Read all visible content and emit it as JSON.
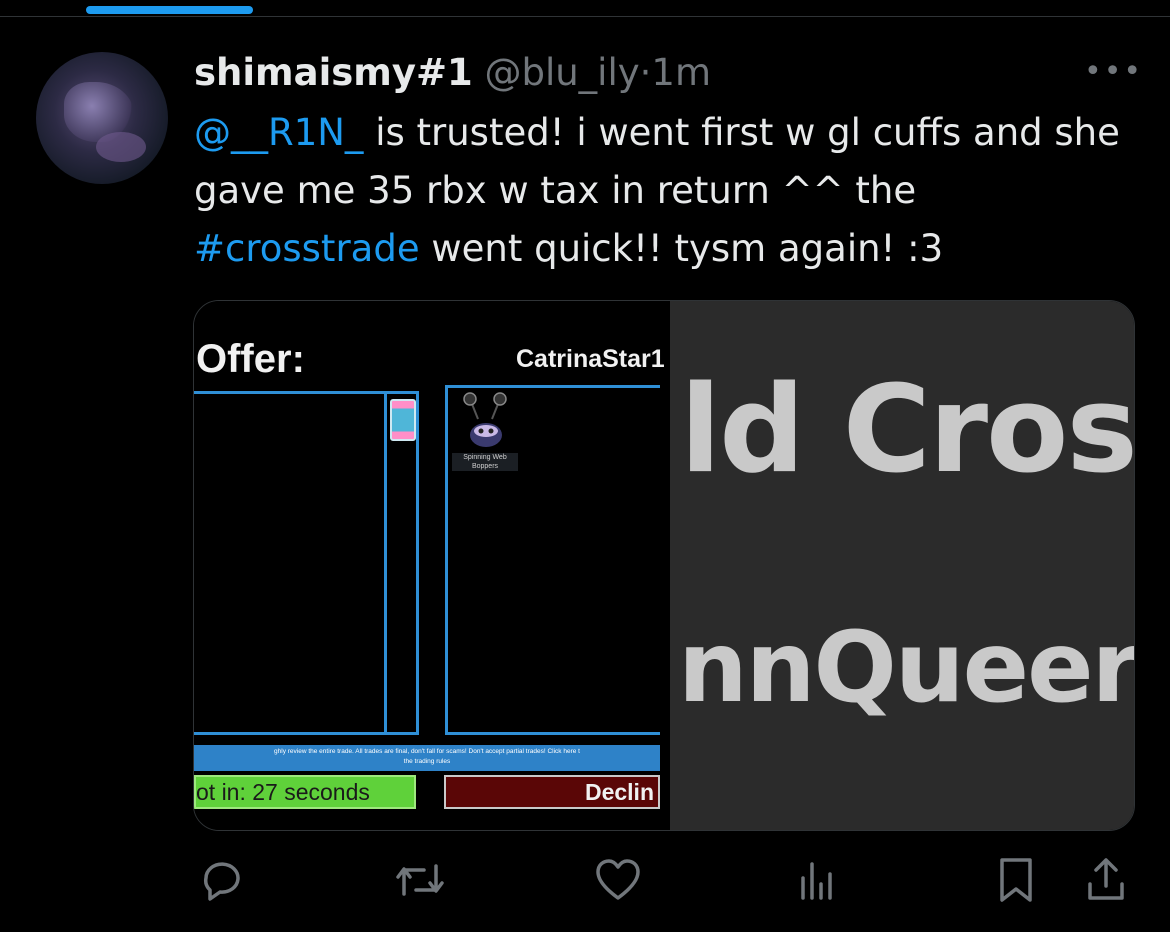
{
  "tweet": {
    "display_name": "shimaismy#1",
    "handle": "@blu_ily",
    "separator": "·",
    "time": "1m",
    "more": "•••",
    "text_parts": [
      {
        "type": "mention",
        "text": "@__R1N_"
      },
      {
        "type": "text",
        "text": " is trusted! i went first w gl cuffs and she gave me 35 rbx w tax in return ^^ the "
      },
      {
        "type": "hashtag",
        "text": "#crosstrade"
      },
      {
        "type": "text",
        "text": " went quick!! tysm again! :3"
      }
    ]
  },
  "media": {
    "trade": {
      "offer_label": "Offer:",
      "partner_name": "CatrinaStar1",
      "item_name": "Spinning Web Boppers",
      "rules_text_line1": "ghly review the entire trade. All trades are final, don't fall for scams! Don't accept partial trades! Click here t",
      "rules_text_line2": "the trading rules",
      "accept_text": "ot in: 27 seconds",
      "decline_text": "Declin"
    },
    "zoom": {
      "line1": "ld Cros",
      "line2": "nnQueer"
    }
  },
  "actions": {
    "reply": "reply-icon",
    "retweet": "retweet-icon",
    "like": "heart-icon",
    "views": "views-icon",
    "bookmark": "bookmark-icon",
    "share": "share-icon"
  },
  "colors": {
    "accent": "#1d9bf0",
    "muted": "#71767b",
    "text": "#e7e9ea",
    "trade_border": "#2f8fd6",
    "accept_green": "#5fd13a",
    "decline_red": "#5a0606"
  }
}
